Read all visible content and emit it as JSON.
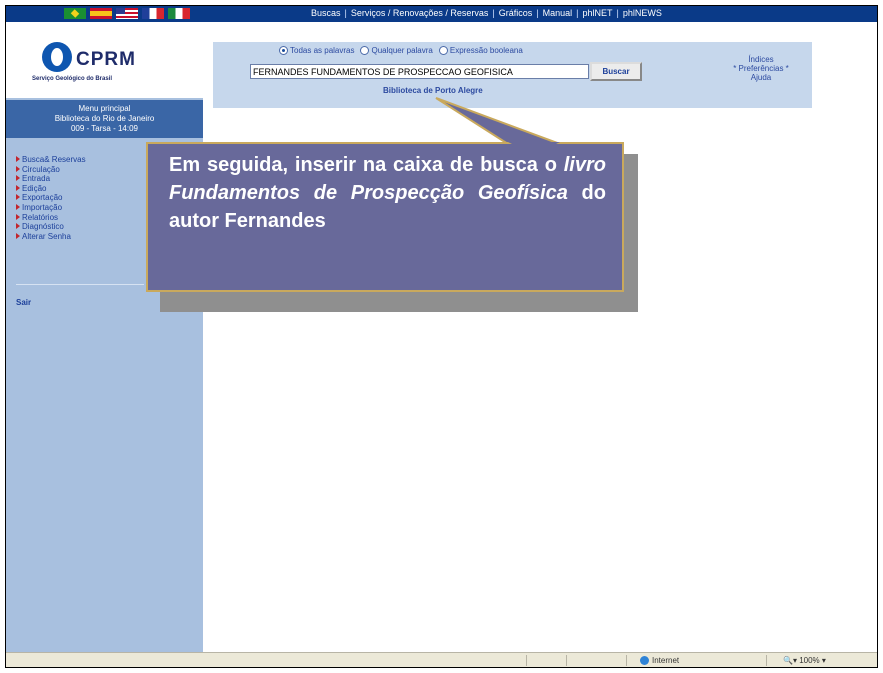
{
  "flags": [
    "brazil-flag",
    "spain-flag",
    "usa-flag",
    "france-flag",
    "italy-flag"
  ],
  "topnav": {
    "links": [
      "Buscas",
      "Serviços / Renovações / Reservas",
      "Gráficos",
      "Manual",
      "phlNET",
      "phlNEWS"
    ],
    "separator": "|"
  },
  "logo": {
    "name": "CPRM",
    "subtitle": "Serviço Geológico do Brasil"
  },
  "menu_header": {
    "title": "Menu principal",
    "library": "Biblioteca do Rio de Janeiro",
    "session": "009 - Tarsa - 14:09"
  },
  "menu": {
    "items": [
      "Busca& Reservas",
      "Circulação",
      "Entrada",
      "Edição",
      "Exportação",
      "Importação",
      "Relatórios",
      "Diagnóstico",
      "Alterar Senha"
    ],
    "logout": "Sair"
  },
  "search": {
    "options": [
      {
        "label": "Todas as palavras",
        "selected": true
      },
      {
        "label": "Qualquer palavra",
        "selected": false
      },
      {
        "label": "Expressão booleana",
        "selected": false
      }
    ],
    "query": "FERNANDES FUNDAMENTOS DE PROSPECCAO GEOFISICA",
    "button": "Buscar",
    "library": "Biblioteca de Porto Alegre"
  },
  "right_links": [
    "Índices",
    "* Preferências *",
    "Ajuda"
  ],
  "callout": {
    "part1": "Em seguida, inserir na caixa de busca o ",
    "italic": "livro Fundamentos de Prospecção Geofísica",
    "part2": " do autor Fernandes"
  },
  "statusbar": {
    "zone": "Internet",
    "zoom": "100%"
  },
  "colors": {
    "nav_blue": "#0a3a88",
    "sidebar": "#a8c0df",
    "panel": "#c6d7ec",
    "callout": "#68699a",
    "callout_border": "#c9a95d"
  }
}
